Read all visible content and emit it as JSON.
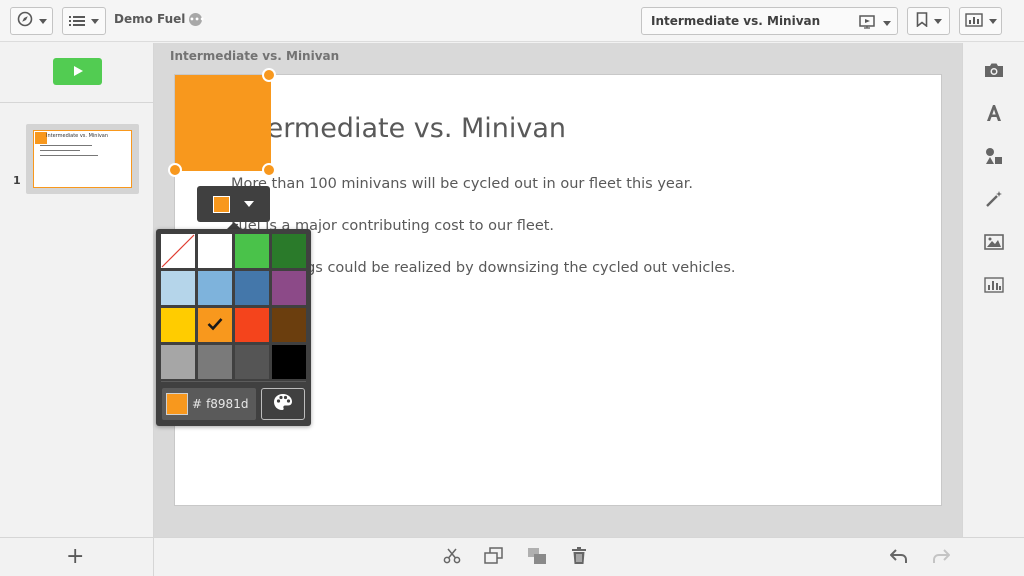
{
  "app": {
    "title": "Demo Fuel",
    "more_glyph": "•••"
  },
  "toolbar": {
    "nav_icon": "compass-icon",
    "list_icon": "list-icon",
    "story_name": "Intermediate vs. Minivan",
    "story_icons": [
      "play-slideshow-icon",
      "bookmark-icon",
      "sheet-view-icon"
    ]
  },
  "left_panel": {
    "play_icon": "play-icon",
    "slides": [
      {
        "number": "1",
        "thumb_title": "Intermediate vs. Minivan"
      }
    ],
    "add_label": "+"
  },
  "canvas": {
    "slide_label": "Intermediate vs. Minivan",
    "slide": {
      "title": "Intermediate vs. Minivan",
      "bullets": [
        "More than 100 minivans will be cycled out in our fleet this year.",
        "Fuel is a major contributing cost to our fleet.",
        "Cost savings could be realized by downsizing the cycled out vehicles."
      ],
      "shape_color": "#f8981d"
    }
  },
  "color_picker": {
    "selected_color": "#f8981d",
    "hex_prefix": "#",
    "hex_value": "f8981d",
    "swatches": [
      [
        "none",
        "#ffffff",
        "#4ac24a",
        "#2a7a2a"
      ],
      [
        "#b5d5ea",
        "#7eb3dc",
        "#4477aa",
        "#8c4a88"
      ],
      [
        "#ffcc00",
        "#f8981d",
        "#f4441c",
        "#6b3e0e"
      ],
      [
        "#a6a6a6",
        "#7a7a7a",
        "#555555",
        "#000000"
      ]
    ],
    "selected_index": [
      2,
      1
    ],
    "palette_icon": "palette-icon"
  },
  "right_toolbar": {
    "tools": [
      "camera-icon",
      "text-icon",
      "shapes-icon",
      "effects-wand-icon",
      "image-icon",
      "chart-icon"
    ]
  },
  "bottom_toolbar": {
    "tools": [
      "cut-icon",
      "duplicate-icon",
      "arrange-icon",
      "delete-icon"
    ],
    "undo_icon": "undo-icon",
    "redo_icon": "redo-icon"
  }
}
